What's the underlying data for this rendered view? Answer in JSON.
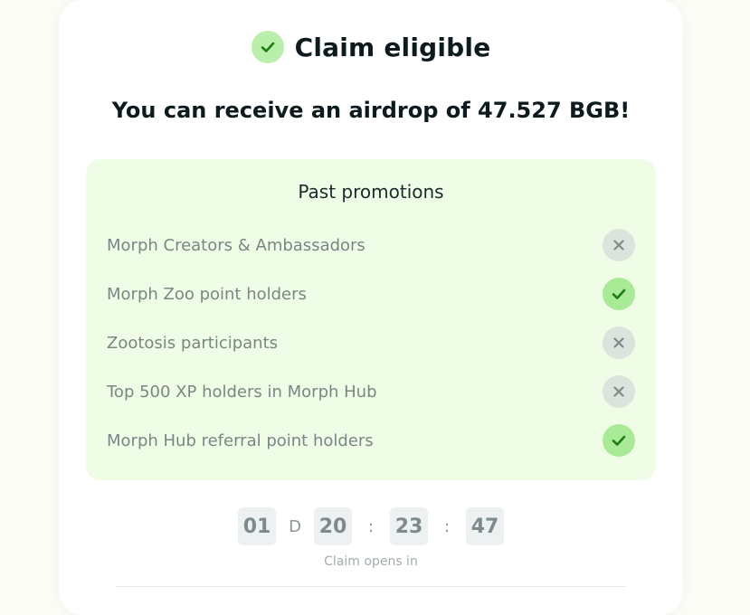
{
  "header": {
    "status_title": "Claim eligible",
    "status_icon": "check-icon",
    "airdrop_message": "You can receive an airdrop of 47.527 BGB!"
  },
  "promotions": {
    "title": "Past promotions",
    "items": [
      {
        "label": "Morph Creators & Ambassadors",
        "eligible": false
      },
      {
        "label": "Morph Zoo point holders",
        "eligible": true
      },
      {
        "label": "Zootosis participants",
        "eligible": false
      },
      {
        "label": "Top 500 XP holders in Morph Hub",
        "eligible": false
      },
      {
        "label": "Morph Hub referral point holders",
        "eligible": true
      }
    ]
  },
  "countdown": {
    "days": "01",
    "days_unit": "D",
    "hours": "20",
    "minutes": "23",
    "seconds": "47",
    "separator": ":",
    "caption": "Claim opens in"
  },
  "colors": {
    "eligible_badge": "#a9ea96",
    "ineligible_badge": "#dbe3dd",
    "panel_bg": "#f0fde6",
    "check_stroke": "#1e7d12",
    "cross_stroke": "#7d8a88"
  }
}
